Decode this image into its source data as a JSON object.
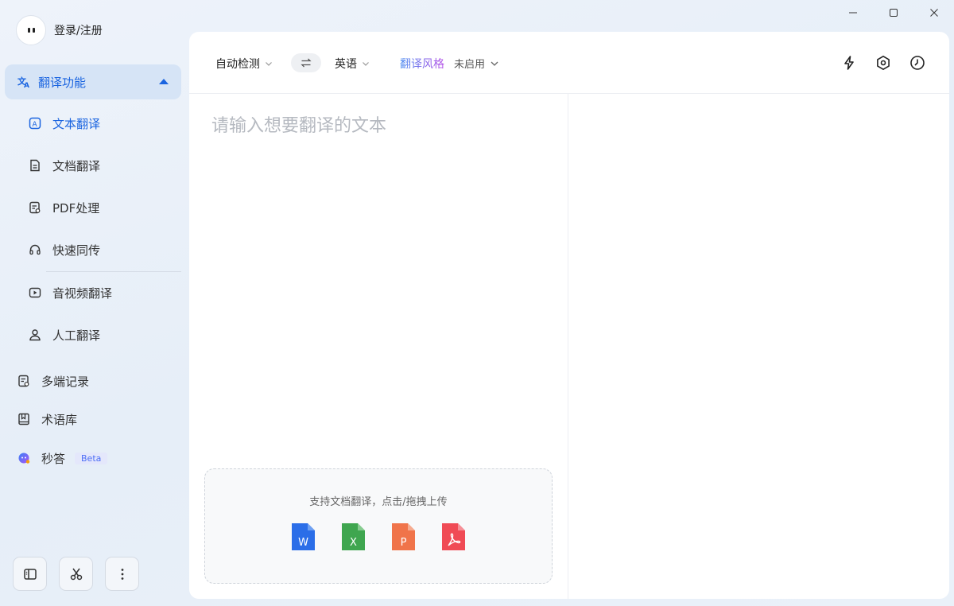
{
  "window": {
    "minimize": "minimize",
    "maximize": "maximize",
    "close": "close"
  },
  "user": {
    "login_label": "登录/注册"
  },
  "sidebar": {
    "group": {
      "label": "翻译功能",
      "icon": "translate-icon",
      "expanded": true
    },
    "sub_items": [
      {
        "label": "文本翻译",
        "icon": "text-translate-icon",
        "active": true
      },
      {
        "label": "文档翻译",
        "icon": "document-icon",
        "active": false
      },
      {
        "label": "PDF处理",
        "icon": "pdf-icon",
        "active": false
      },
      {
        "label": "快速同传",
        "icon": "headset-icon",
        "active": false
      },
      {
        "label": "音视频翻译",
        "icon": "video-icon",
        "active": false
      },
      {
        "label": "人工翻译",
        "icon": "person-icon",
        "active": false
      }
    ],
    "main_items": [
      {
        "label": "多端记录",
        "icon": "record-icon"
      },
      {
        "label": "术语库",
        "icon": "book-icon"
      },
      {
        "label": "秒答",
        "icon": "ai-bot-icon",
        "badge": "Beta"
      }
    ],
    "bottom_buttons": [
      "sidebar-toggle-icon",
      "scissors-icon",
      "more-vertical-icon"
    ]
  },
  "toolbar": {
    "source_lang": "自动检测",
    "target_lang": "英语",
    "style_label": "翻译风格",
    "style_value": "未启用",
    "icons": [
      "lightning-icon",
      "settings-hex-icon",
      "history-icon"
    ]
  },
  "editor": {
    "placeholder": "请输入想要翻译的文本"
  },
  "dropzone": {
    "text": "支持文档翻译，点击/拖拽上传",
    "file_types": [
      {
        "label": "W",
        "color": "#2b6ee8",
        "icon": "word-file-icon"
      },
      {
        "label": "X",
        "color": "#3fa64f",
        "icon": "excel-file-icon"
      },
      {
        "label": "P",
        "color": "#f0744a",
        "icon": "ppt-file-icon"
      },
      {
        "label": "",
        "color": "#f04b55",
        "icon": "pdf-file-icon"
      }
    ]
  },
  "colors": {
    "accent": "#1a64e0",
    "sidebar_active_bg": "#d6e4f6"
  }
}
